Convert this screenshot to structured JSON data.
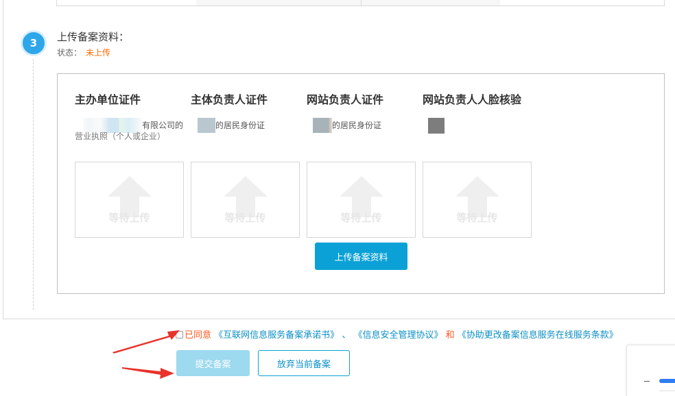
{
  "step": {
    "number": "3",
    "title": "上传备案资料：",
    "status_label": "状态：",
    "status_value": "未上传"
  },
  "columns": [
    {
      "heading": "主办单位证件",
      "desc_line1": "有限公司的",
      "desc_line2": "营业执照（个人或企业）",
      "slot_text": "等待上传"
    },
    {
      "heading": "主体负责人证件",
      "desc_line1": "的居民身份证",
      "desc_line2": "",
      "slot_text": "等待上传"
    },
    {
      "heading": "网站负责人证件",
      "desc_line1": "的居民身份证",
      "desc_line2": "",
      "slot_text": "等待上传"
    },
    {
      "heading": "网站负责人人脸核验",
      "desc_line1": "",
      "desc_line2": "",
      "slot_text": "等待上传"
    }
  ],
  "upload_button": "上传备案资料",
  "agreement": {
    "prefix": "已同意",
    "link1": "《互联网信息服务备案承诺书》",
    "sep": "、",
    "link2": "《信息安全管理协议》",
    "and": "和",
    "link3": "《协助更改备案信息服务在线服务条款》"
  },
  "actions": {
    "submit": "提交备案",
    "abandon": "放弃当前备案"
  },
  "colors": {
    "accent": "#0ba1d6",
    "step_circle": "#2ea6ea",
    "status": "#ff6a00",
    "annotation_arrow": "#e8322b"
  },
  "icons": {
    "upload": "upload-arrow-icon",
    "checkbox": "checkbox-icon"
  }
}
